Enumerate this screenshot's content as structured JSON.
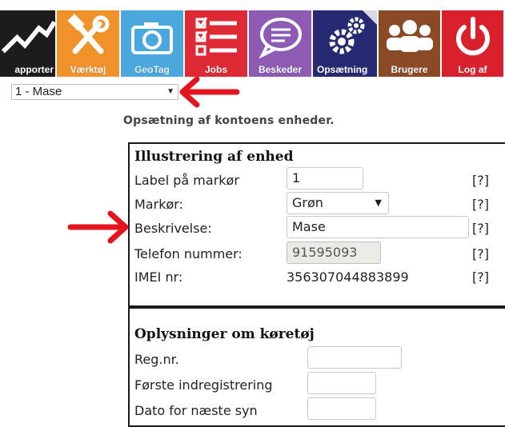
{
  "toolbar": {
    "tiles": [
      {
        "label": "apporter",
        "icon": "chart-line-icon",
        "color": "#1c1c1c"
      },
      {
        "label": "Værktøj",
        "icon": "tools-icon",
        "color": "#f0912a"
      },
      {
        "label": "GeoTag",
        "icon": "camera-icon",
        "color": "#4aa8dc"
      },
      {
        "label": "Jobs",
        "icon": "checklist-icon",
        "color": "#dd2a35"
      },
      {
        "label": "Beskeder",
        "icon": "chat-bubble-icon",
        "color": "#8e5bb4"
      },
      {
        "label": "Opsætning",
        "icon": "gears-icon",
        "color": "#262a72"
      },
      {
        "label": "Brugere",
        "icon": "users-icon",
        "color": "#8a4a26"
      },
      {
        "label": "Log af",
        "icon": "power-icon",
        "color": "#d8212c"
      }
    ]
  },
  "unit_select": {
    "value": "1 - Mase"
  },
  "heading": "Opsætning af kontoens enheder.",
  "illustration": {
    "title": "Illustrering af enhed",
    "help": "[?]",
    "rows": {
      "label": {
        "label": "Label på markør",
        "value": "1"
      },
      "marker": {
        "label": "Markør:",
        "value": "Grøn"
      },
      "description": {
        "label": "Beskrivelse:",
        "value": "Mase"
      },
      "phone": {
        "label": "Telefon nummer:",
        "value": "91595093"
      },
      "imei": {
        "label": "IMEI nr:",
        "value": "356307044883899"
      }
    }
  },
  "vehicle": {
    "title": "Oplysninger om køretøj",
    "rows": {
      "reg": {
        "label": "Reg.nr.",
        "value": ""
      },
      "first_reg": {
        "label": "Første indregistrering",
        "value": ""
      },
      "next_inspection": {
        "label": "Dato for næste syn",
        "value": ""
      }
    }
  },
  "annotation_color": "#e4151f"
}
